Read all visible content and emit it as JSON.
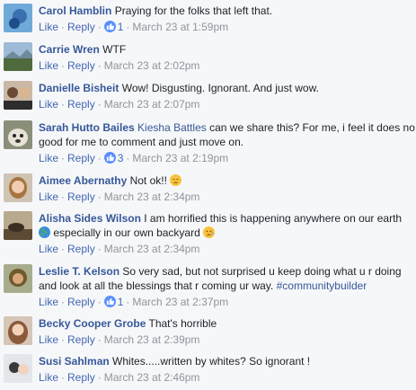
{
  "comments": [
    {
      "author": "Carol Hamblin",
      "text": "Praying for the folks that left that.",
      "like": "Like",
      "reply": "Reply",
      "reactions": "1",
      "time": "March 23 at 1:59pm"
    },
    {
      "author": "Carrie Wren",
      "text": "WTF",
      "like": "Like",
      "reply": "Reply",
      "time": "March 23 at 2:02pm"
    },
    {
      "author": "Danielle Bisheit",
      "text": "Wow! Disgusting. Ignorant. And just wow.",
      "like": "Like",
      "reply": "Reply",
      "time": "March 23 at 2:07pm"
    },
    {
      "author": "Sarah Hutto Bailes",
      "mention": "Kiesha Battles",
      "text": "can we share this? For me, i feel it does no",
      "text2": "good for me to comment and just move on.",
      "like": "Like",
      "reply": "Reply",
      "reactions": "3",
      "time": "March 23 at 2:19pm"
    },
    {
      "author": "Aimee Abernathy",
      "text": "Not ok!!",
      "emoji": "pensive-face-icon",
      "like": "Like",
      "reply": "Reply",
      "time": "March 23 at 2:34pm"
    },
    {
      "author": "Alisha Sides Wilson",
      "text": "I am horrified this is happening anywhere on our earth",
      "text2": "especially in our own backyard",
      "emoji_start": "globe-icon",
      "emoji": "sad-face-icon",
      "like": "Like",
      "reply": "Reply",
      "time": "March 23 at 2:34pm"
    },
    {
      "author": "Leslie T. Kelson",
      "text": "So very sad, but not surprised u keep doing what u r doing",
      "text2": "and look at all the blessings that r coming ur way.",
      "hashtag": "#communitybuilder",
      "like": "Like",
      "reply": "Reply",
      "reactions": "1",
      "time": "March 23 at 2:37pm"
    },
    {
      "author": "Becky Cooper Grobe",
      "text": "That's horrible",
      "like": "Like",
      "reply": "Reply",
      "time": "March 23 at 2:39pm"
    },
    {
      "author": "Susi Sahlman",
      "text": "Whites.....written by whites? So ignorant !",
      "like": "Like",
      "reply": "Reply",
      "time": "March 23 at 2:46pm"
    }
  ],
  "separator": "·",
  "colors": {
    "link": "#365899",
    "meta": "#90949c",
    "like_icon": "#5890ff"
  }
}
